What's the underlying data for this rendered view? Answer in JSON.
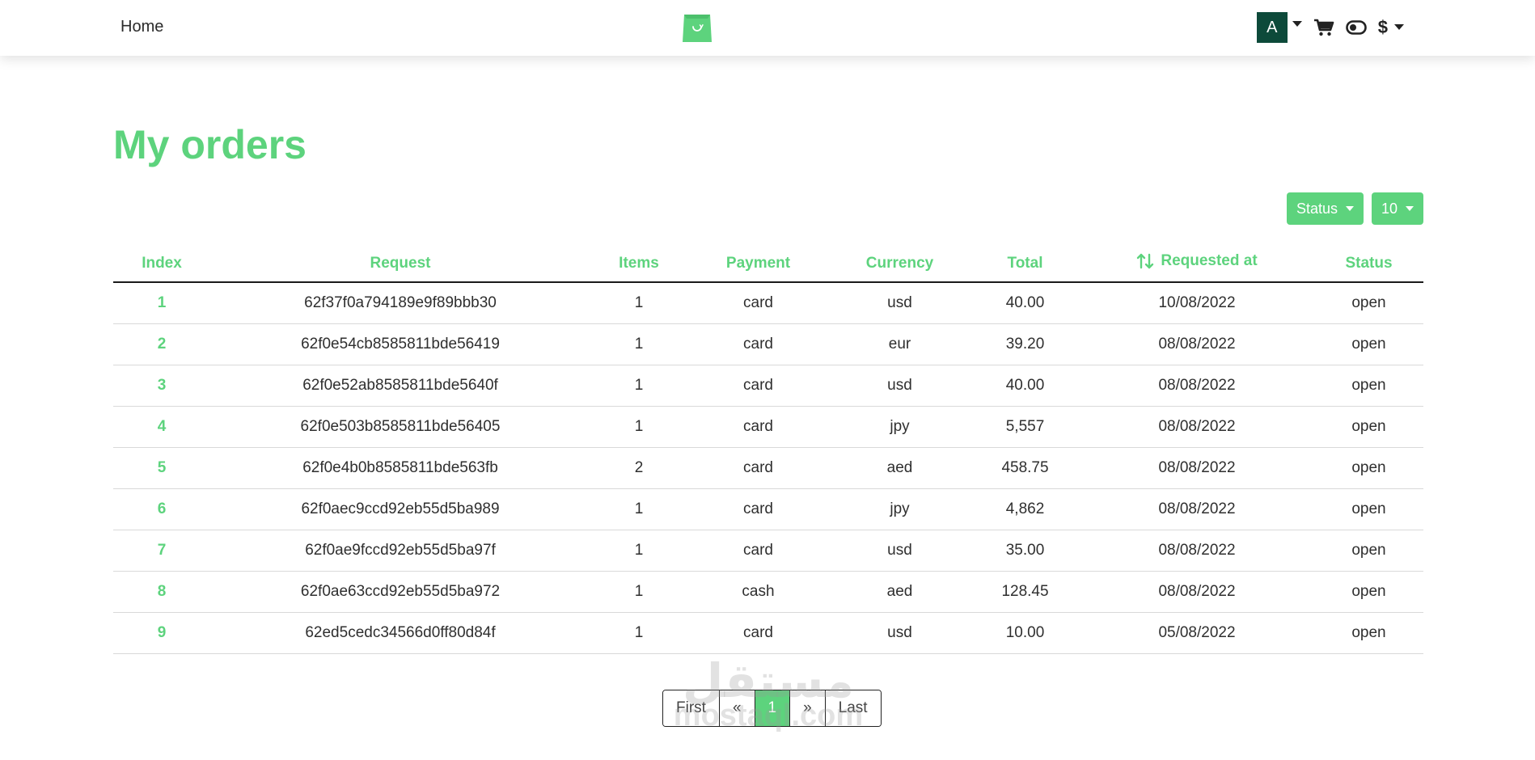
{
  "navbar": {
    "home_label": "Home",
    "avatar_initial": "A",
    "currency_symbol": "$"
  },
  "colors": {
    "accent": "#5dd37d",
    "avatar_bg": "#0d4a3a"
  },
  "icons": {
    "logo": "shopping-bag-icon",
    "cart": "cart-icon",
    "theme_toggle": "toggle-icon",
    "sort": "sort-arrows-icon"
  },
  "page": {
    "title": "My orders"
  },
  "filters": {
    "status_label": "Status",
    "page_size_label": "10"
  },
  "table": {
    "headers": {
      "index": "Index",
      "request": "Request",
      "items": "Items",
      "payment": "Payment",
      "currency": "Currency",
      "total": "Total",
      "requested_at": "Requested at",
      "status": "Status"
    },
    "rows": [
      {
        "index": "1",
        "request": "62f37f0a794189e9f89bbb30",
        "items": "1",
        "payment": "card",
        "currency": "usd",
        "total": "40.00",
        "requested_at": "10/08/2022",
        "status": "open"
      },
      {
        "index": "2",
        "request": "62f0e54cb8585811bde56419",
        "items": "1",
        "payment": "card",
        "currency": "eur",
        "total": "39.20",
        "requested_at": "08/08/2022",
        "status": "open"
      },
      {
        "index": "3",
        "request": "62f0e52ab8585811bde5640f",
        "items": "1",
        "payment": "card",
        "currency": "usd",
        "total": "40.00",
        "requested_at": "08/08/2022",
        "status": "open"
      },
      {
        "index": "4",
        "request": "62f0e503b8585811bde56405",
        "items": "1",
        "payment": "card",
        "currency": "jpy",
        "total": "5,557",
        "requested_at": "08/08/2022",
        "status": "open"
      },
      {
        "index": "5",
        "request": "62f0e4b0b8585811bde563fb",
        "items": "2",
        "payment": "card",
        "currency": "aed",
        "total": "458.75",
        "requested_at": "08/08/2022",
        "status": "open"
      },
      {
        "index": "6",
        "request": "62f0aec9ccd92eb55d5ba989",
        "items": "1",
        "payment": "card",
        "currency": "jpy",
        "total": "4,862",
        "requested_at": "08/08/2022",
        "status": "open"
      },
      {
        "index": "7",
        "request": "62f0ae9fccd92eb55d5ba97f",
        "items": "1",
        "payment": "card",
        "currency": "usd",
        "total": "35.00",
        "requested_at": "08/08/2022",
        "status": "open"
      },
      {
        "index": "8",
        "request": "62f0ae63ccd92eb55d5ba972",
        "items": "1",
        "payment": "cash",
        "currency": "aed",
        "total": "128.45",
        "requested_at": "08/08/2022",
        "status": "open"
      },
      {
        "index": "9",
        "request": "62ed5cedc34566d0ff80d84f",
        "items": "1",
        "payment": "card",
        "currency": "usd",
        "total": "10.00",
        "requested_at": "05/08/2022",
        "status": "open"
      }
    ]
  },
  "pagination": {
    "first": "First",
    "prev": "«",
    "current": "1",
    "next": "»",
    "last": "Last"
  },
  "watermark": {
    "arabic": "مستقل",
    "latin": "mostaql.com"
  }
}
